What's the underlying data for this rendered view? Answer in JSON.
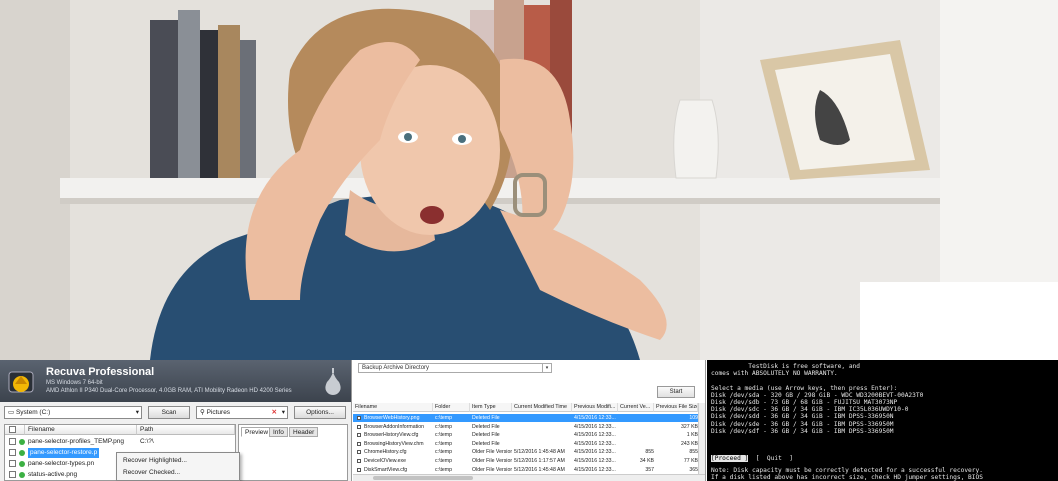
{
  "recuva": {
    "title": "Recuva Professional",
    "os": "MS Windows 7 64-bit",
    "hardware": "AMD Athlon II P340 Dual-Core Processor, 4.0GB RAM, ATI Mobility Radeon HD 4200 Series",
    "drive_select": "System (C:)",
    "scan_label": "Scan",
    "filter_value": "Pictures",
    "options_label": "Options...",
    "columns": {
      "filename": "Filename",
      "path": "Path"
    },
    "rows": [
      {
        "name": "pane-selector-profiles_TEMP.png",
        "path": "C:\\?\\"
      },
      {
        "name": "pane-selector-restore.p",
        "path": ""
      },
      {
        "name": "pane-selector-types.pn",
        "path": ""
      },
      {
        "name": "status-active.png",
        "path": ""
      }
    ],
    "tabs": [
      "Preview",
      "Info",
      "Header"
    ],
    "context_menu": [
      "Recover Highlighted...",
      "Recover Checked..."
    ]
  },
  "file_list": {
    "combo_value": "Backup Archive Directory",
    "start_label": "Start",
    "columns": [
      "Filename",
      "Folder",
      "Item Type",
      "Current Modified Time",
      "Previous Modifi...",
      "Current Ve...",
      "Previous File Size"
    ],
    "rows": [
      [
        "BrowserWebHistory.png",
        "c:\\temp",
        "Deleted File",
        "",
        "4/15/2016 12:33...",
        "",
        "109"
      ],
      [
        "BrowserAddonInformation",
        "c:\\temp",
        "Deleted File",
        "",
        "4/15/2016 12:33...",
        "",
        "327 KB"
      ],
      [
        "BrowserHistoryView.cfg",
        "c:\\temp",
        "Deleted File",
        "",
        "4/15/2016 12:33...",
        "",
        "1 KB"
      ],
      [
        "BrowsingHistoryView.chm",
        "c:\\temp",
        "Deleted File",
        "",
        "4/15/2016 12:33...",
        "",
        "243 KB"
      ],
      [
        "ChromeHistory.cfg",
        "c:\\temp",
        "Older File Version",
        "5/12/2016 1:45:48 AM",
        "4/15/2016 12:33...",
        "855",
        "855"
      ],
      [
        "DeviceIOView.exe",
        "c:\\temp",
        "Older File Version",
        "5/12/2016 1:17:57 AM",
        "4/15/2016 12:33...",
        "34 KB",
        "77 KB"
      ],
      [
        "DiskSmartView.cfg",
        "c:\\temp",
        "Older File Version",
        "5/12/2016 1:45:48 AM",
        "4/15/2016 12:33...",
        "357",
        "365"
      ]
    ]
  },
  "testdisk": {
    "lines": [
      "          TestDisk is free software, and",
      "comes with ABSOLUTELY NO WARRANTY.",
      "",
      "Select a media (use Arrow keys, then press Enter):",
      "Disk /dev/sda - 320 GB / 298 GiB - WDC WD3200BEVT-00A23T0",
      "Disk /dev/sdb - 73 GB / 68 GiB - FUJITSU MAT3073NP",
      "Disk /dev/sdc - 36 GB / 34 GiB - IBM IC35L036UWDY10-0",
      "Disk /dev/sdd - 36 GB / 34 GiB - IBM DPSS-336950N",
      "Disk /dev/sde - 36 GB / 34 GiB - IBM DPSS-336950M",
      "Disk /dev/sdf - 36 GB / 34 GiB - IBM DPSS-336950M"
    ],
    "proceed_label": "[Proceed ]",
    "quit_label": "[  Quit  ]",
    "note_lines": [
      "Note: Disk capacity must be correctly detected for a successful recovery.",
      "If a disk listed above has incorrect size, check HD jumper settings, BIOS"
    ]
  }
}
